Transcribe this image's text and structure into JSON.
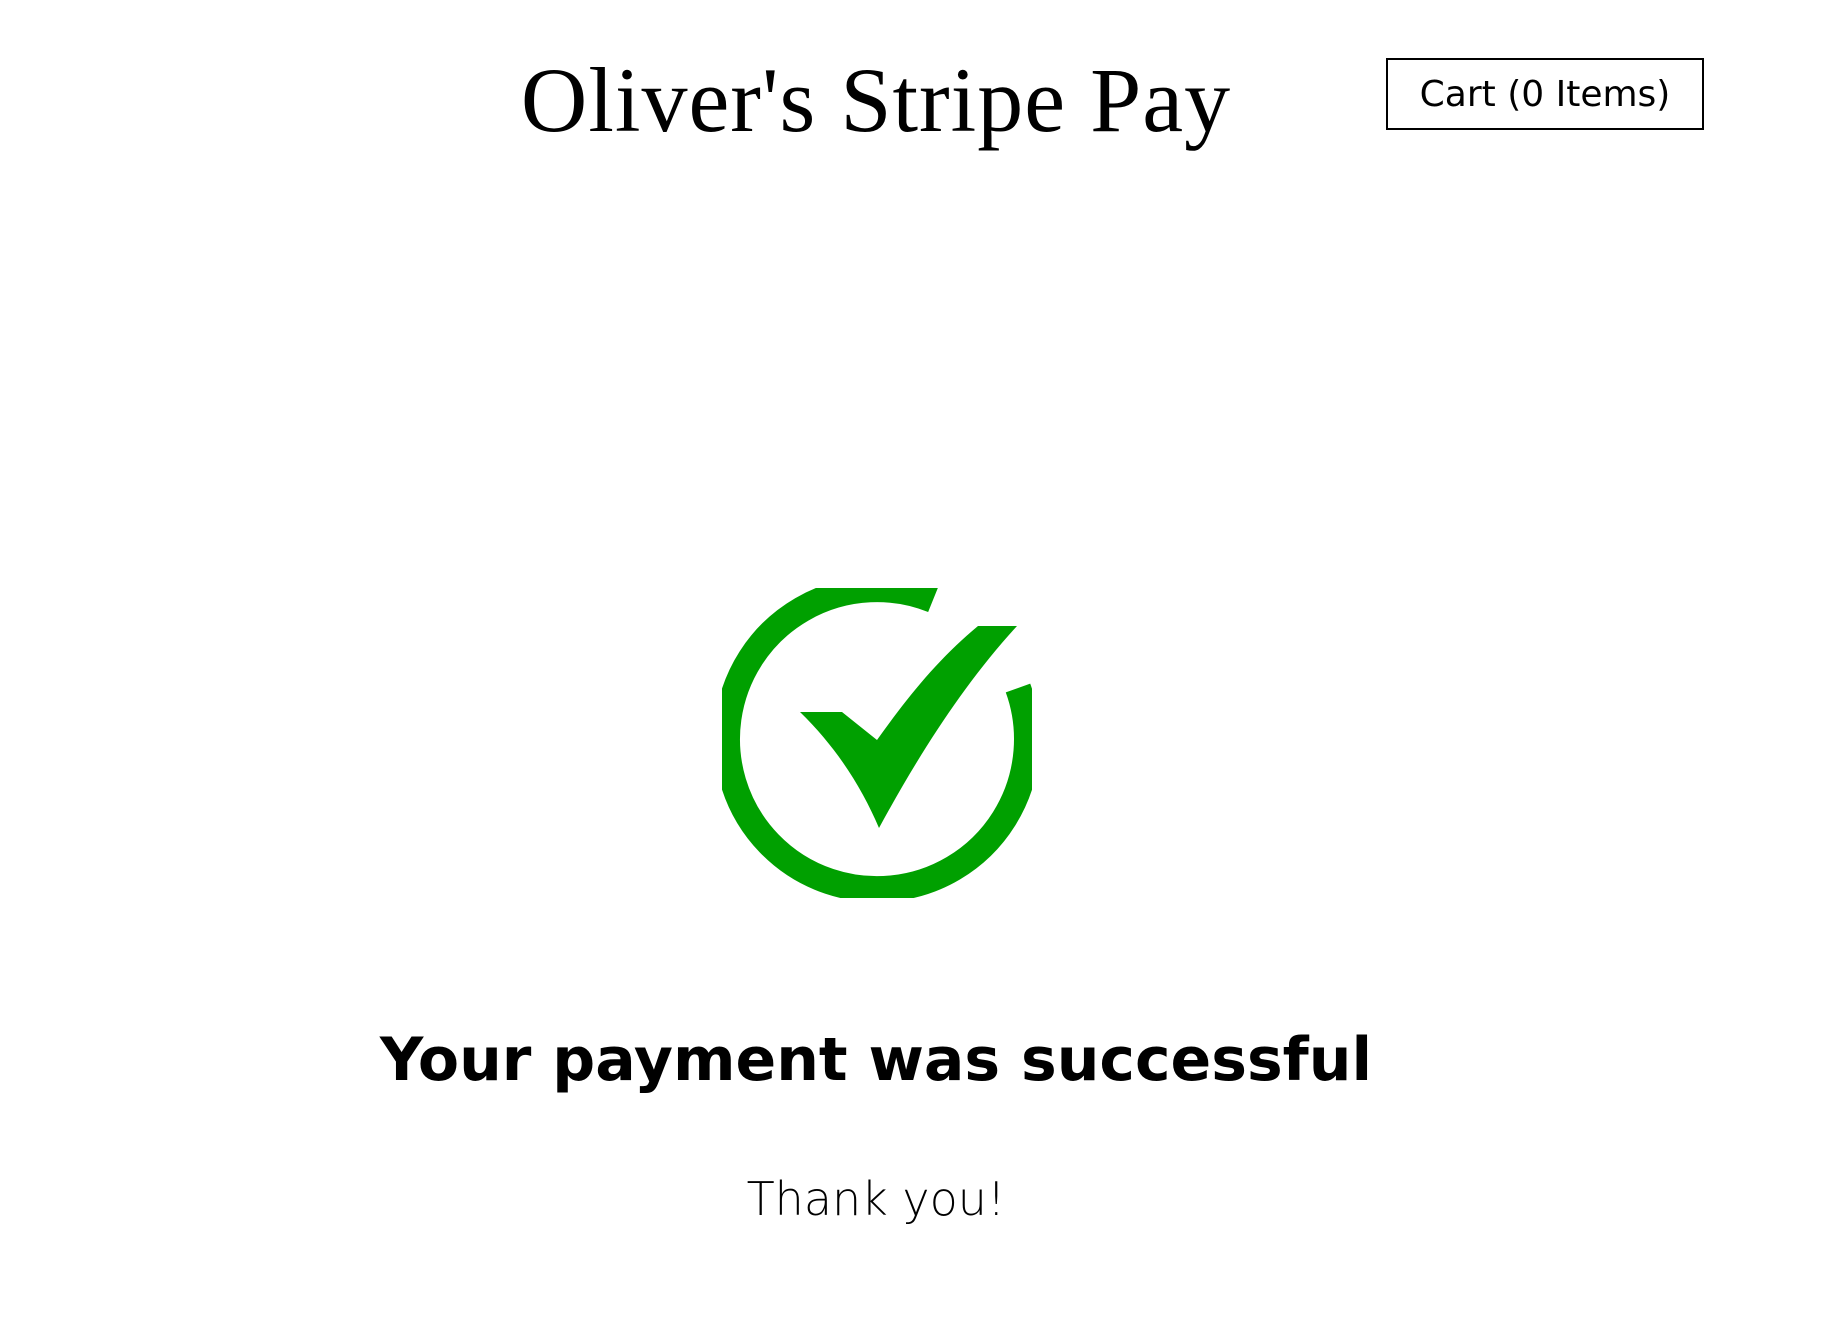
{
  "header": {
    "site_title": "Oliver's Stripe Pay",
    "cart_label": "Cart (0 Items)"
  },
  "main": {
    "icon": "check-circle-icon",
    "icon_color": "#00a000",
    "heading": "Your payment was successful",
    "message": "Thank you!"
  }
}
